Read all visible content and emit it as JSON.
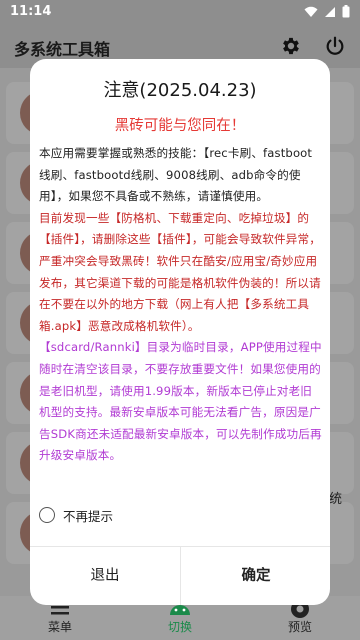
{
  "status_bar": {
    "time": "11:14"
  },
  "app": {
    "title": "多系统工具箱",
    "side_fragment": "统"
  },
  "bottom_nav": {
    "items": [
      {
        "label": "菜单",
        "icon": "menu-icon"
      },
      {
        "label": "切换",
        "icon": "android-icon",
        "color": "#1b8a4a"
      },
      {
        "label": "预览",
        "icon": "preview-icon"
      }
    ]
  },
  "dialog": {
    "title": "注意(2025.04.23)",
    "subtitle": "黑砖可能与您同在！",
    "paragraphs": [
      "本应用需要掌握或熟悉的技能：【rec卡刷、fastboot线刷、fastbootd线刷、9008线刷、adb命令的使用】，如果您不具备或不熟练，请谨慎使用。",
      "目前发现一些【防格机、下载重定向、吃掉垃圾】的【插件】，请删除这些【插件】，可能会导致软件异常，严重冲突会导致黑砖！软件只在酷安/应用宝/奇妙应用发布，其它渠道下载的可能是格机软件伪装的！所以请在不要在以外的地方下载（网上有人把【多系统工具箱.apk】恶意改成格机软件）。",
      "【sdcard/Rannki】目录为临时目录，APP使用过程中随时在清空该目录，不要存放重要文件！如果您使用的是老旧机型，请使用1.99版本，新版本已停止对老旧机型的支持。最新安卓版本可能无法看广告，原因是广告SDK商还未适配最新安卓版本，可以先制作成功后再升级安卓版本。"
    ],
    "checkbox_label": "不再提示",
    "checkbox_checked": false,
    "exit_label": "退出",
    "confirm_label": "确定"
  },
  "colors": {
    "subtitle": "#e53935",
    "warning_text": "#c62828",
    "info_text": "#b13bd3"
  }
}
